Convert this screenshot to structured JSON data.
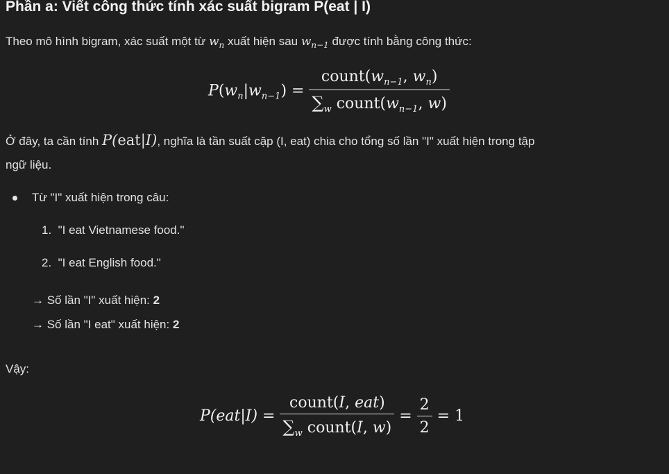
{
  "heading": "Phần a: Viết công thức tính xác suất bigram P(eat | I)",
  "intro": {
    "prefix": "Theo mô hình bigram, xác suất một từ ",
    "mid": " xuất hiện sau ",
    "suffix": " được tính bằng công thức:"
  },
  "formula1": {
    "lhs": "P(w",
    "numerator": "count(w",
    "denominator": "count(w"
  },
  "explain": {
    "prefix": "Ở đây, ta cần tính ",
    "suffix": ", nghĩa là tần suất cặp (I, eat) chia cho tổng số lần \"I\" xuất hiện trong tập",
    "line2": "ngữ liệu."
  },
  "bullet": "Từ \"I\" xuất hiện trong câu:",
  "list": [
    {
      "num": "1.",
      "text": "\"I eat Vietnamese food.\""
    },
    {
      "num": "2.",
      "text": "\"I eat English food.\""
    }
  ],
  "results": [
    {
      "label": "→ Số lần \"I\" xuất hiện: ",
      "value": "2"
    },
    {
      "label": "→ Số lần \"I eat\" xuất hiện: ",
      "value": "2"
    }
  ],
  "conclusion": "Vậy:",
  "formula2": {
    "lhs": "P(eat|I) =",
    "numerator": "count(I, eat)",
    "denominator": "count(I, w)",
    "frac_num": "2",
    "frac_den": "2",
    "result": "= 1"
  }
}
